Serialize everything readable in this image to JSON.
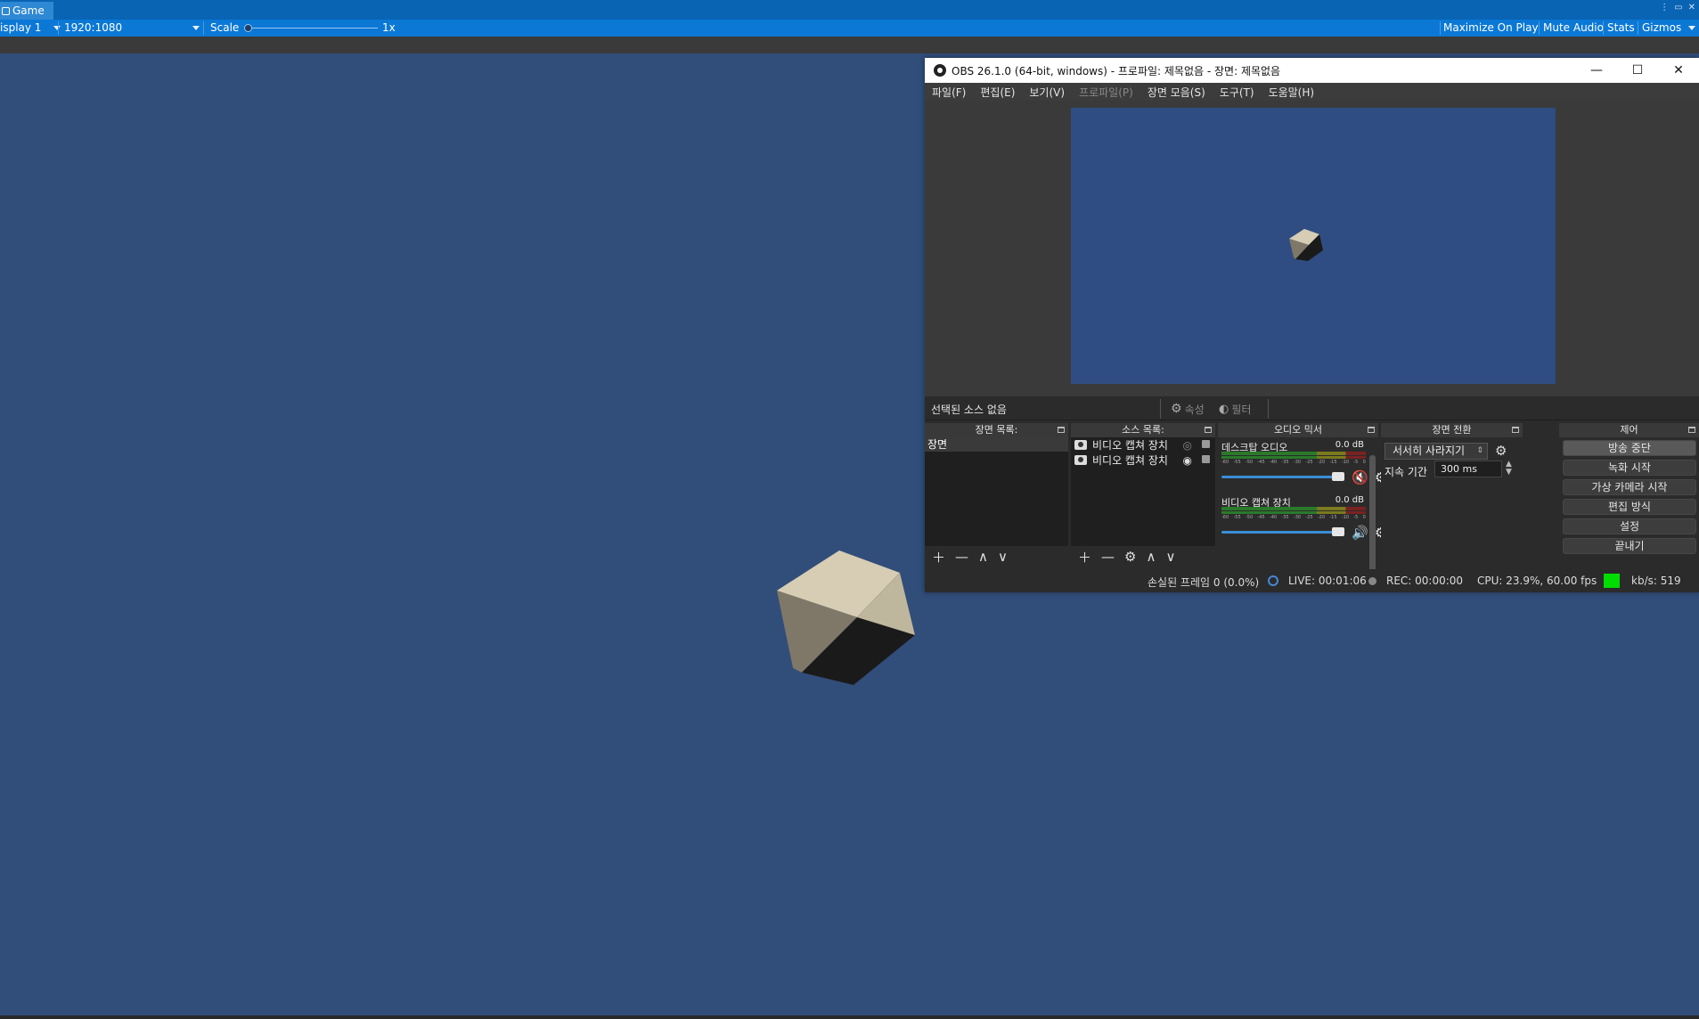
{
  "unity": {
    "tab_title": "Game",
    "display": "isplay 1",
    "resolution": "1920:1080",
    "scale_label": "Scale",
    "scale_value": "1x",
    "toggles": [
      "Maximize On Play",
      "Mute Audio",
      "Stats",
      "Gizmos"
    ]
  },
  "obs": {
    "title": "OBS 26.1.0 (64-bit, windows) - 프로파일: 제목없음 - 장면: 제목없음",
    "menu": [
      "파일(F)",
      "편집(E)",
      "보기(V)",
      "프로파일(P)",
      "장면 모음(S)",
      "도구(T)",
      "도움말(H)"
    ],
    "menu_disabled_index": 3,
    "source_bar": {
      "no_source": "선택된 소스 없음",
      "properties": "속성",
      "filters": "필터"
    },
    "scenes": {
      "header": "장면 목록:",
      "items": [
        "장면"
      ]
    },
    "sources": {
      "header": "소스 목록:",
      "items": [
        "비디오 캡쳐 장치",
        "비디오 캡쳐 장치"
      ]
    },
    "mixer": {
      "header": "오디오 믹서",
      "channels": [
        {
          "name": "데스크탑 오디오",
          "db": "0.0 dB",
          "muted": true
        },
        {
          "name": "비디오 캡쳐 장치",
          "db": "0.0 dB",
          "muted": false
        }
      ],
      "meter_ticks": [
        "-60",
        "-55",
        "-50",
        "-45",
        "-40",
        "-35",
        "-30",
        "-25",
        "-20",
        "-15",
        "-10",
        "-5",
        "0"
      ]
    },
    "transitions": {
      "header": "장면 전환",
      "selected": "서서히 사라지기",
      "duration_label": "지속 기간",
      "duration_value": "300 ms"
    },
    "controls": {
      "header": "제어",
      "buttons": [
        "방송 중단",
        "녹화 시작",
        "가상 카메라 시작",
        "편집 방식",
        "설정",
        "끝내기"
      ]
    },
    "status": {
      "dropped": "손실된 프레임 0 (0.0%)",
      "live": "LIVE: 00:01:06",
      "rec": "REC: 00:00:00",
      "cpu": "CPU: 23.9%, 60.00 fps",
      "kbs": "kb/s: 519"
    }
  },
  "colors": {
    "game_bg": "#314d7a",
    "unity_bar": "#0b78d6",
    "cube_top": "#d6cdb4",
    "cube_left": "#7f7868",
    "cube_right": "#1a1a1a",
    "status_ok": "#00dd00",
    "mute_red": "#e02020"
  }
}
